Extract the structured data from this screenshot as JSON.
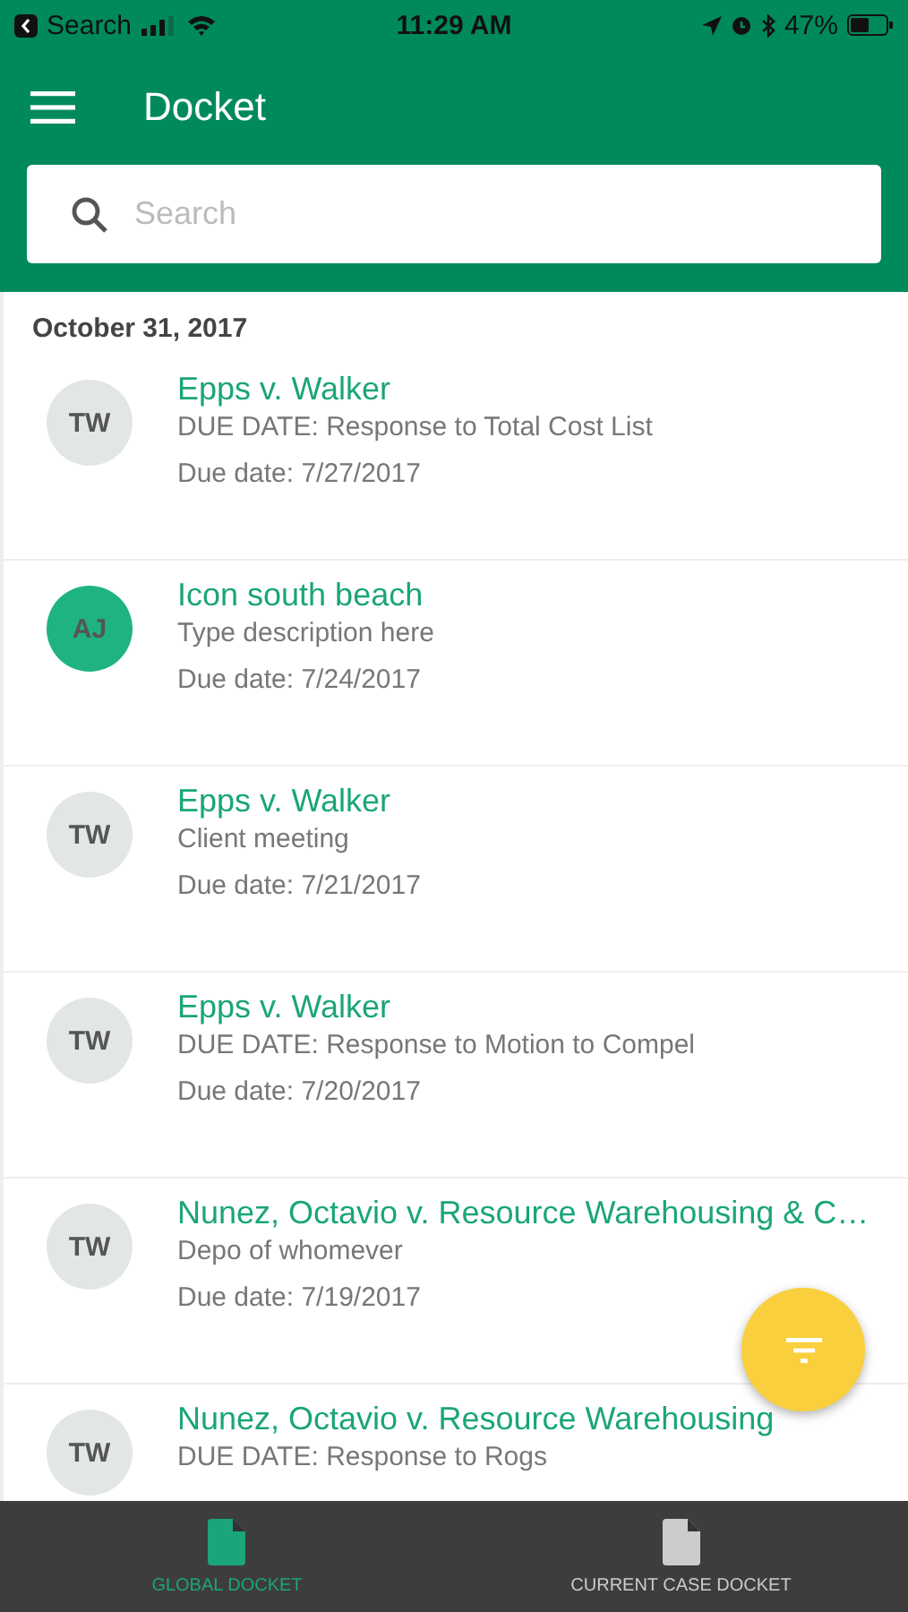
{
  "status_bar": {
    "back_label": "Search",
    "time": "11:29 AM",
    "battery": "47%"
  },
  "header": {
    "title": "Docket"
  },
  "search": {
    "placeholder": "Search"
  },
  "date_header": "October 31, 2017",
  "items": [
    {
      "initials": "TW",
      "color": "#e3e6e6",
      "title": "Epps v. Walker",
      "description": "DUE DATE: Response to Total Cost List",
      "due": "Due date: 7/27/2017"
    },
    {
      "initials": "AJ",
      "color": "#1fb384",
      "title": "Icon south beach",
      "description": "Type description here",
      "due": "Due date: 7/24/2017"
    },
    {
      "initials": "TW",
      "color": "#e3e6e6",
      "title": "Epps v. Walker",
      "description": "Client meeting",
      "due": "Due date: 7/21/2017"
    },
    {
      "initials": "TW",
      "color": "#e3e6e6",
      "title": "Epps v. Walker",
      "description": "DUE DATE: Response to Motion to Compel",
      "due": "Due date: 7/20/2017"
    },
    {
      "initials": "TW",
      "color": "#e3e6e6",
      "title": "Nunez, Octavio v. Resource Warehousing & C…",
      "description": "Depo of whomever",
      "due": "Due date: 7/19/2017"
    },
    {
      "initials": "TW",
      "color": "#e3e6e6",
      "title": "Nunez, Octavio v. Resource Warehousing",
      "description": "DUE DATE: Response to Rogs"
    }
  ],
  "tabs": [
    {
      "label": "GLOBAL DOCKET",
      "selected": true
    },
    {
      "label": "CURRENT CASE DOCKET",
      "selected": false
    }
  ]
}
